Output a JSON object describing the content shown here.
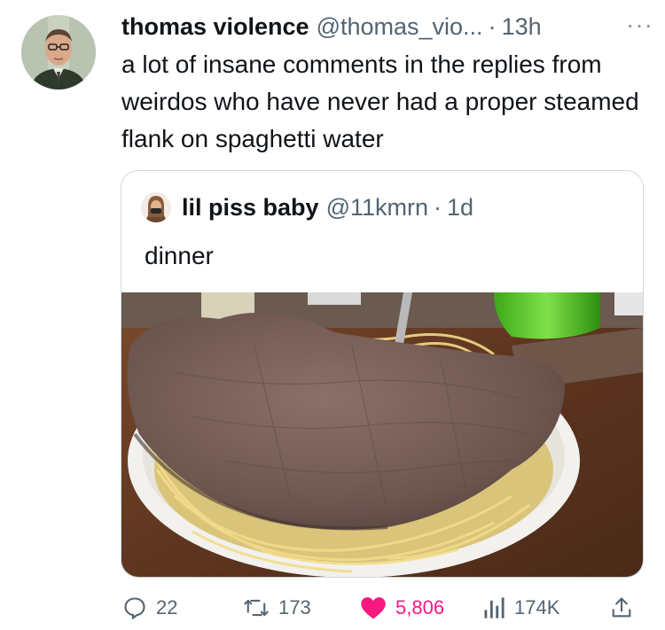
{
  "tweet": {
    "author_name": "thomas violence",
    "handle": "@thomas_vio...",
    "separator": "·",
    "time": "13h",
    "more": "···",
    "text": "a lot of insane comments in the replies from weirdos who have never had a proper steamed flank on spaghetti water"
  },
  "quoted": {
    "author_name": "lil piss baby",
    "handle": "@11kmrn",
    "separator": "·",
    "time": "1d",
    "text": "dinner"
  },
  "actions": {
    "replies": "22",
    "retweets": "173",
    "likes": "5,806",
    "views": "174K"
  },
  "colors": {
    "text": "#0f1419",
    "secondary": "#536471",
    "border": "#cfd9de",
    "like": "#f91880"
  }
}
